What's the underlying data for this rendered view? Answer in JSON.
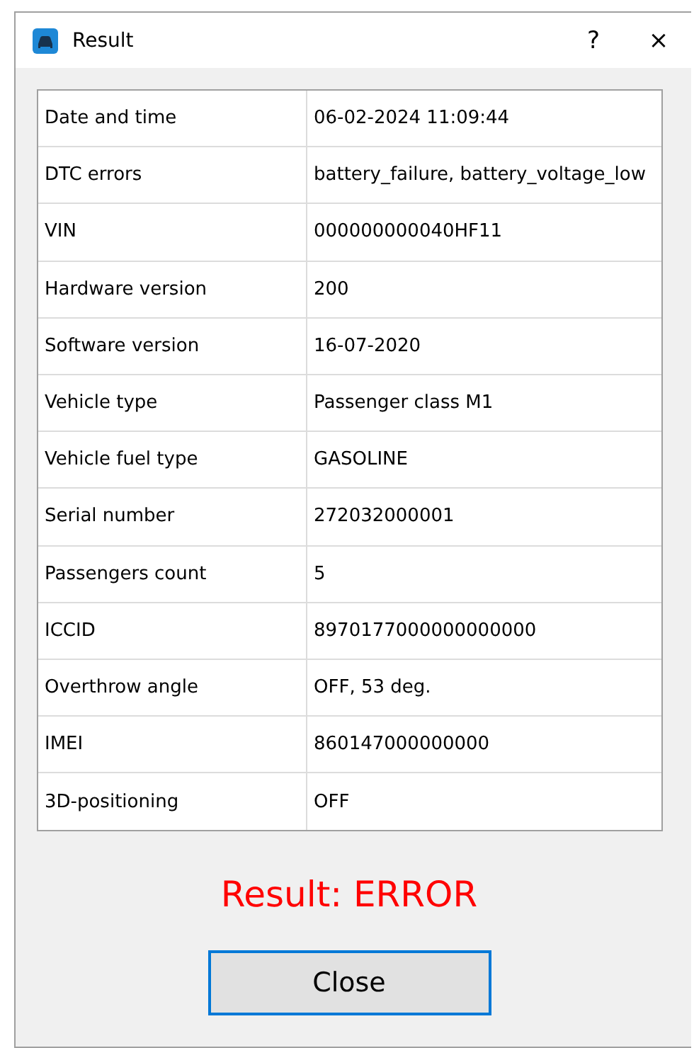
{
  "window": {
    "title": "Result",
    "help": "?",
    "close": "×"
  },
  "table": {
    "rows": [
      {
        "label": "Date and time",
        "value": "06-02-2024 11:09:44"
      },
      {
        "label": "DTC errors",
        "value": "battery_failure, battery_voltage_low"
      },
      {
        "label": "VIN",
        "value": "000000000040HF11"
      },
      {
        "label": "Hardware version",
        "value": "200"
      },
      {
        "label": "Software version",
        "value": "16-07-2020"
      },
      {
        "label": "Vehicle type",
        "value": "Passenger class M1"
      },
      {
        "label": "Vehicle fuel type",
        "value": "GASOLINE"
      },
      {
        "label": "Serial number",
        "value": "272032000001"
      },
      {
        "label": "Passengers count",
        "value": "5"
      },
      {
        "label": "ICCID",
        "value": "8970177000000000000"
      },
      {
        "label": "Overthrow angle",
        "value": "OFF, 53 deg."
      },
      {
        "label": "IMEI",
        "value": "860147000000000"
      },
      {
        "label": "3D-positioning",
        "value": "OFF"
      }
    ]
  },
  "result": {
    "text": "Result: ERROR"
  },
  "buttons": [
    {
      "label": "Close",
      "focused": true
    }
  ]
}
